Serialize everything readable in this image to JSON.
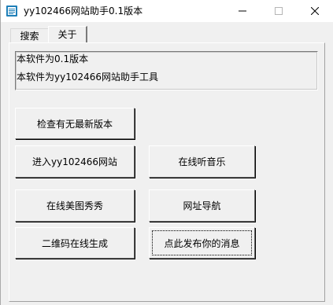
{
  "window": {
    "title": "yy102466网站助手0.1版本",
    "icon": "notepad-icon"
  },
  "tabs": [
    {
      "label": "搜索",
      "active": false
    },
    {
      "label": "关于",
      "active": true
    }
  ],
  "info": {
    "line1": "本软件为0.1版本",
    "line2": "本软件为yy102466网站助手工具"
  },
  "buttons": {
    "check_update": "检查有无最新版本",
    "enter_site": "进入yy102466网站",
    "music": "在线听音乐",
    "meitu": "在线美图秀秀",
    "nav": "网址导航",
    "qrcode": "二维码在线生成",
    "post_message": "点此发布你的消息"
  },
  "colors": {
    "background": "#f0f0f0",
    "titlebar": "#ffffff"
  }
}
